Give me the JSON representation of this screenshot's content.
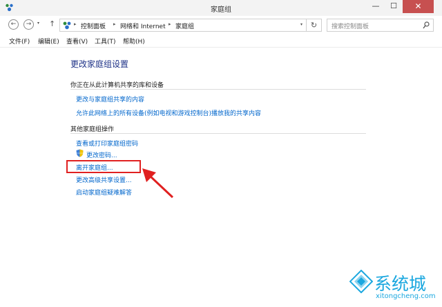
{
  "window": {
    "title": "家庭组",
    "minimize": "—",
    "maximize": "☐",
    "close": "✕"
  },
  "nav": {
    "back": "←",
    "forward": "→",
    "up": "↑",
    "dropdown": "▾",
    "refresh": "↻"
  },
  "address": {
    "crumbs": [
      "控制面板",
      "网络和 Internet",
      "家庭组"
    ],
    "separator": "▸"
  },
  "search": {
    "placeholder": "搜索控制面板"
  },
  "menubar": [
    "文件(F)",
    "编辑(E)",
    "查看(V)",
    "工具(T)",
    "帮助(H)"
  ],
  "main": {
    "heading": "更改家庭组设置",
    "section1": {
      "title": "你正在从此计算机共享的库和设备",
      "links": [
        "更改与家庭组共享的内容",
        "允许此网络上的所有设备(例如电视和游戏控制台)播放我的共享内容"
      ]
    },
    "section2": {
      "title": "其他家庭组操作",
      "links": [
        "查看或打印家庭组密码",
        "更改密码...",
        "离开家庭组...",
        "更改高级共享设置...",
        "启动家庭组疑难解答"
      ]
    }
  },
  "watermark": {
    "brand": "系统城",
    "domain": "xitongcheng.com"
  },
  "colors": {
    "link": "#0066cc",
    "heading": "#1e3287",
    "highlight": "#e02020",
    "close_button": "#c75050",
    "watermark": "#1aa7df"
  }
}
